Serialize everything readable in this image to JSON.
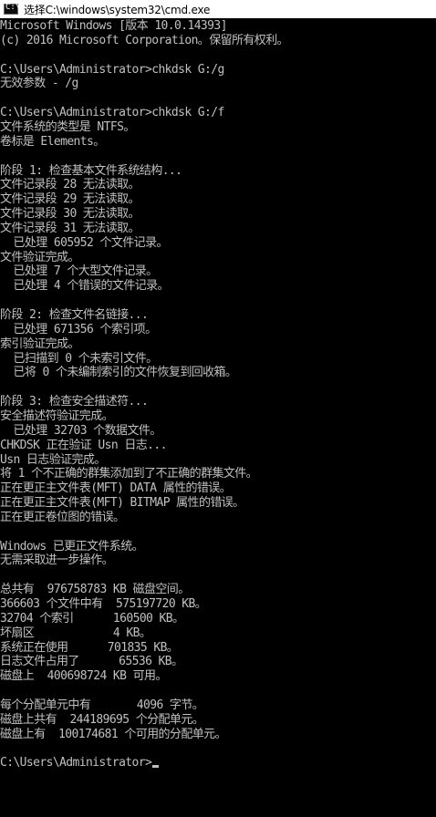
{
  "window": {
    "title": "选择C:\\windows\\system32\\cmd.exe",
    "icon": "cmd-icon",
    "icon_glyph": "C:\\"
  },
  "console": {
    "prompt": "C:\\Users\\Administrator>",
    "lines": [
      "Microsoft Windows [版本 10.0.14393]",
      "(c) 2016 Microsoft Corporation。保留所有权利。",
      "",
      "C:\\Users\\Administrator>chkdsk G:/g",
      "无效参数 - /g",
      "",
      "C:\\Users\\Administrator>chkdsk G:/f",
      "文件系统的类型是 NTFS。",
      "卷标是 Elements。",
      "",
      "阶段 1: 检查基本文件系统结构...",
      "文件记录段 28 无法读取。",
      "文件记录段 29 无法读取。",
      "文件记录段 30 无法读取。",
      "文件记录段 31 无法读取。",
      "  已处理 605952 个文件记录。",
      "文件验证完成。",
      "  已处理 7 个大型文件记录。",
      "  已处理 4 个错误的文件记录。",
      "",
      "阶段 2: 检查文件名链接...",
      "  已处理 671356 个索引项。",
      "索引验证完成。",
      "  已扫描到 0 个未索引文件。",
      "  已将 0 个未编制索引的文件恢复到回收箱。",
      "",
      "阶段 3: 检查安全描述符...",
      "安全描述符验证完成。",
      "  已处理 32703 个数据文件。",
      "CHKDSK 正在验证 Usn 日志...",
      "Usn 日志验证完成。",
      "将 1 个不正确的群集添加到了不正确的群集文件。",
      "正在更正主文件表(MFT) DATA 属性的错误。",
      "正在更正主文件表(MFT) BITMAP 属性的错误。",
      "正在更正卷位图的错误。",
      "",
      "Windows 已更正文件系统。",
      "无需采取进一步操作。",
      "",
      "总共有  976758783 KB 磁盘空间。",
      "366603 个文件中有  575197720 KB。",
      "32704 个索引      160500 KB。",
      "坏扇区            4 KB。",
      "系统正在使用      701835 KB。",
      "日志文件占用了      65536 KB。",
      "磁盘上  400698724 KB 可用。",
      "",
      "每个分配单元中有       4096 字节。",
      "磁盘上共有  244189695 个分配单元。",
      "磁盘上有  100174681 个可用的分配单元。",
      ""
    ]
  }
}
